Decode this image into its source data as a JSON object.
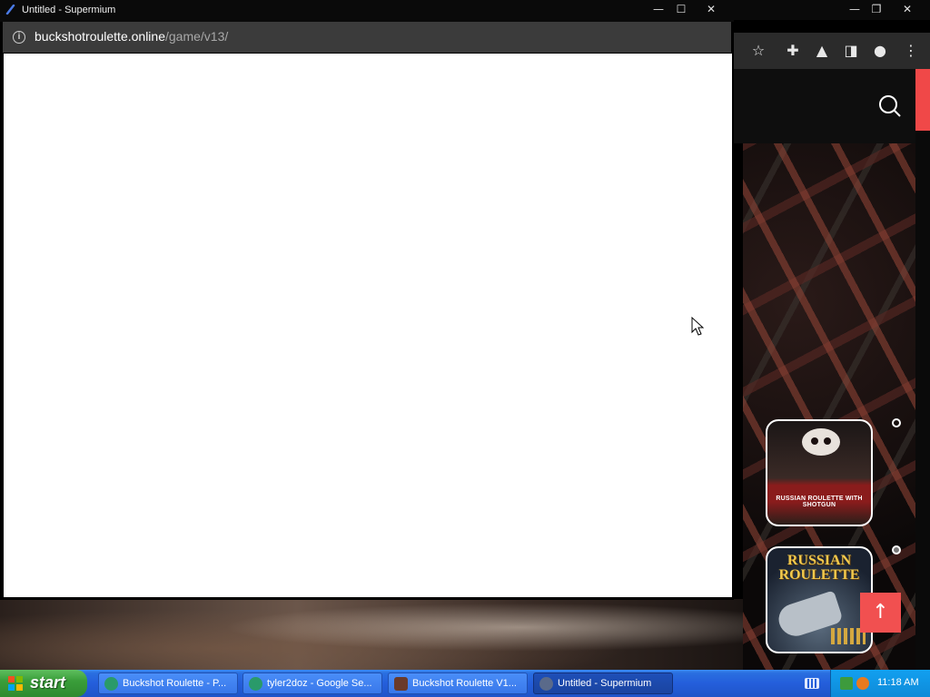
{
  "popup": {
    "title": "Untitled - Supermium",
    "url_host": "buckshotroulette.online",
    "url_path": "/game/v13/"
  },
  "background_page": {
    "cards": [
      {
        "title": "RUSSIAN ROULETTE WITH SHOTGUN"
      },
      {
        "title": "RUSSIAN\nROULETTE"
      }
    ],
    "scroll_top_label": "↑"
  },
  "window_controls": {
    "minimize": "—",
    "maximize": "☐",
    "restore": "❐",
    "close": "✕"
  },
  "taskbar": {
    "start_label": "start",
    "tasks": [
      {
        "label": "Buckshot Roulette - P...",
        "icon": "browser-icon"
      },
      {
        "label": "tyler2doz - Google Se...",
        "icon": "browser-icon"
      },
      {
        "label": "Buckshot Roulette V1...",
        "icon": "game-icon"
      },
      {
        "label": "Untitled - Supermium",
        "icon": "supermium-icon"
      }
    ],
    "clock": "11:18 AM"
  },
  "colors": {
    "xp_blue": "#245edb",
    "start_green": "#3a9e3a",
    "accent_red": "#f15050"
  }
}
